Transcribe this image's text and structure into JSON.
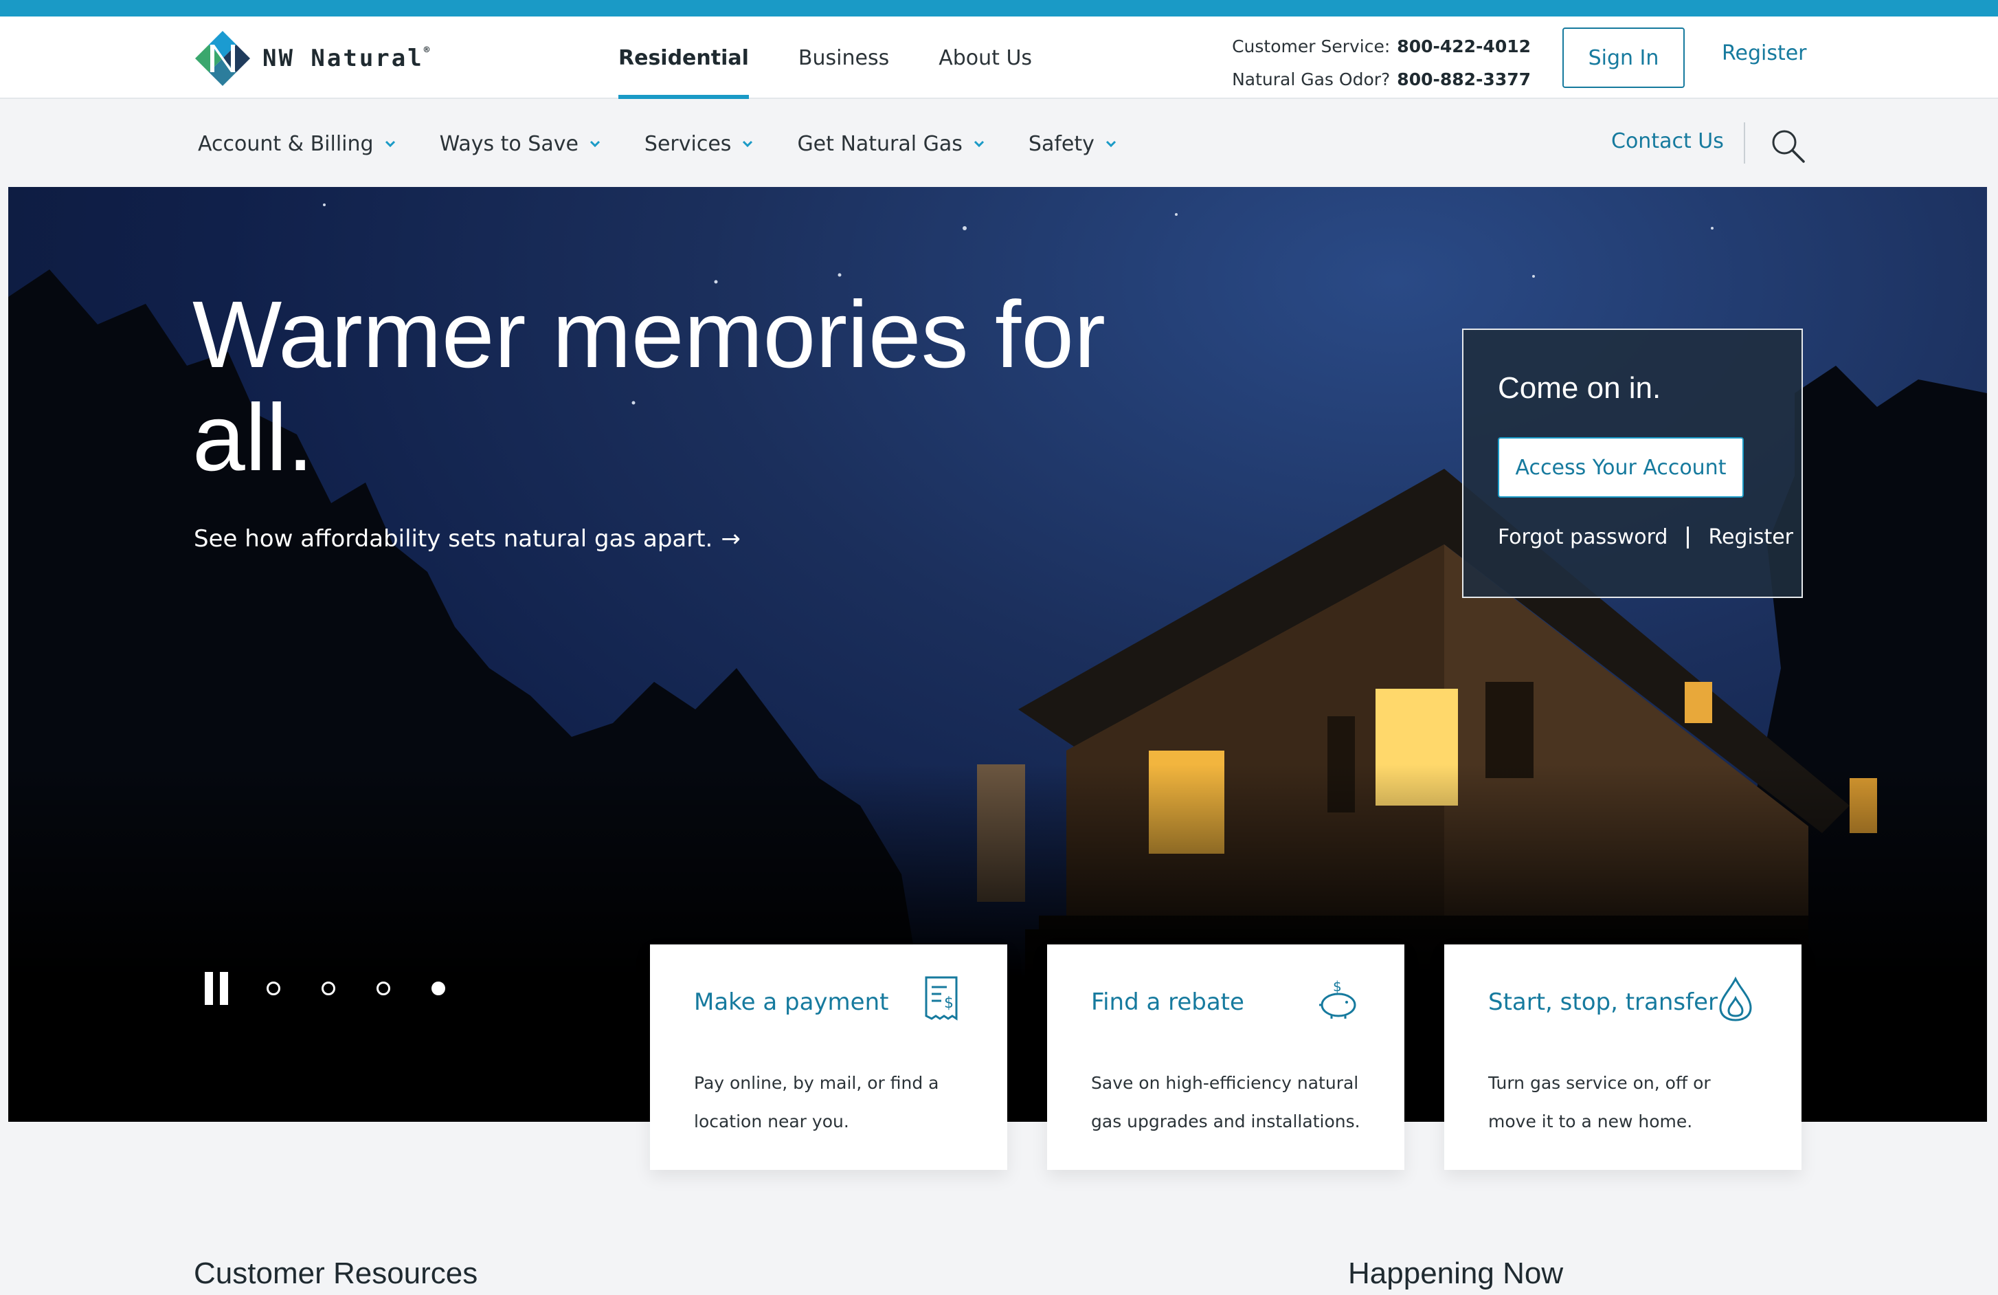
{
  "brand": {
    "name": "NW Natural",
    "reg": "®"
  },
  "primary_nav": [
    {
      "label": "Residential",
      "active": true
    },
    {
      "label": "Business",
      "active": false
    },
    {
      "label": "About Us",
      "active": false
    }
  ],
  "contact": {
    "service_label": "Customer Service:",
    "service_phone": "800-422-4012",
    "odor_label": "Natural Gas Odor?",
    "odor_phone": "800-882-3377"
  },
  "auth": {
    "signin": "Sign In",
    "register": "Register"
  },
  "secondary_nav": [
    {
      "label": "Account & Billing"
    },
    {
      "label": "Ways to Save"
    },
    {
      "label": "Services"
    },
    {
      "label": "Get Natural Gas"
    },
    {
      "label": "Safety"
    }
  ],
  "contact_us": "Contact Us",
  "hero": {
    "title": "Warmer memories for all.",
    "link": "See how affordability sets natural gas apart.",
    "link_arrow": "→"
  },
  "login_box": {
    "heading": "Come on in.",
    "access_button": "Access Your Account",
    "forgot": "Forgot password",
    "register": "Register"
  },
  "carousel": {
    "slides": 4,
    "active_index": 3
  },
  "cards": [
    {
      "title": "Make a payment",
      "description": "Pay online, by mail, or find a location near you.",
      "icon": "receipt-icon"
    },
    {
      "title": "Find a rebate",
      "description": "Save on high-efficiency natural gas upgrades and installations.",
      "icon": "piggy-bank-icon"
    },
    {
      "title": "Start, stop, transfer",
      "description": "Turn gas service on, off or move it to a new home.",
      "icon": "flame-drop-icon"
    }
  ],
  "sections": {
    "customer_resources": "Customer Resources",
    "happening_now": "Happening Now"
  },
  "colors": {
    "accent": "#1a9ac6",
    "link": "#167a9e",
    "text": "#2b3338",
    "background": "#f3f4f6"
  }
}
